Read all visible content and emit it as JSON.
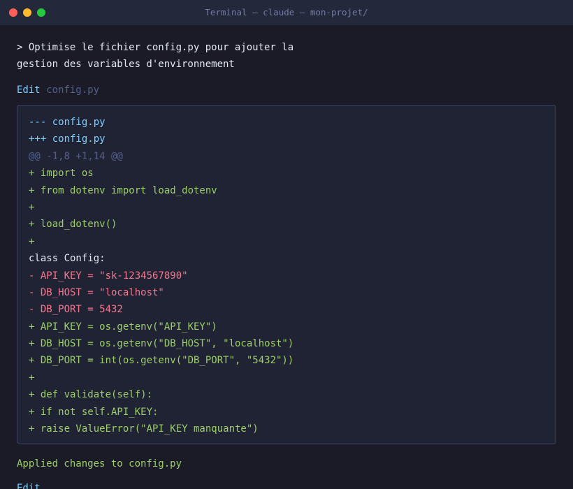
{
  "window": {
    "title": "Terminal — claude — mon-projet/"
  },
  "prompt": {
    "text": "> Optimise le fichier config.py pour ajouter la gestion des variables d'environnement"
  },
  "edit": {
    "label": "Edit",
    "file": "config.py"
  },
  "diff": {
    "lines": [
      {
        "type": "header",
        "text": "--- config.py"
      },
      {
        "type": "header",
        "text": "+++ config.py"
      },
      {
        "type": "hunk",
        "text": "@@ -1,8 +1,14 @@"
      },
      {
        "type": "add",
        "text": "+ import os"
      },
      {
        "type": "add",
        "text": "+ from dotenv import load_dotenv"
      },
      {
        "type": "add",
        "text": "+"
      },
      {
        "type": "add",
        "text": "+ load_dotenv()"
      },
      {
        "type": "add",
        "text": "+"
      },
      {
        "type": "ctx",
        "text": "class Config:"
      },
      {
        "type": "del",
        "text": "- API_KEY = \"sk-1234567890\""
      },
      {
        "type": "del",
        "text": "- DB_HOST = \"localhost\""
      },
      {
        "type": "del",
        "text": "- DB_PORT = 5432"
      },
      {
        "type": "add",
        "text": "+ API_KEY = os.getenv(\"API_KEY\")"
      },
      {
        "type": "add",
        "text": "+ DB_HOST = os.getenv(\"DB_HOST\", \"localhost\")"
      },
      {
        "type": "add",
        "text": "+ DB_PORT = int(os.getenv(\"DB_PORT\", \"5432\"))"
      },
      {
        "type": "add",
        "text": "+"
      },
      {
        "type": "add",
        "text": "+ def validate(self):"
      },
      {
        "type": "add",
        "text": "+ if not self.API_KEY:"
      },
      {
        "type": "add",
        "text": "+ raise ValueError(\"API_KEY manquante\")"
      }
    ]
  },
  "status": {
    "applied": "Applied changes to config.py",
    "next_edit": "Edit"
  },
  "colors": {
    "background": "#1a1b26",
    "titlebar": "#24283b",
    "added": "#9ece6a",
    "removed": "#f7768e",
    "header": "#7dcfff",
    "hunk": "#565f89",
    "close": "#ff5f57",
    "minimize": "#febc2e",
    "maximize": "#28c840"
  }
}
